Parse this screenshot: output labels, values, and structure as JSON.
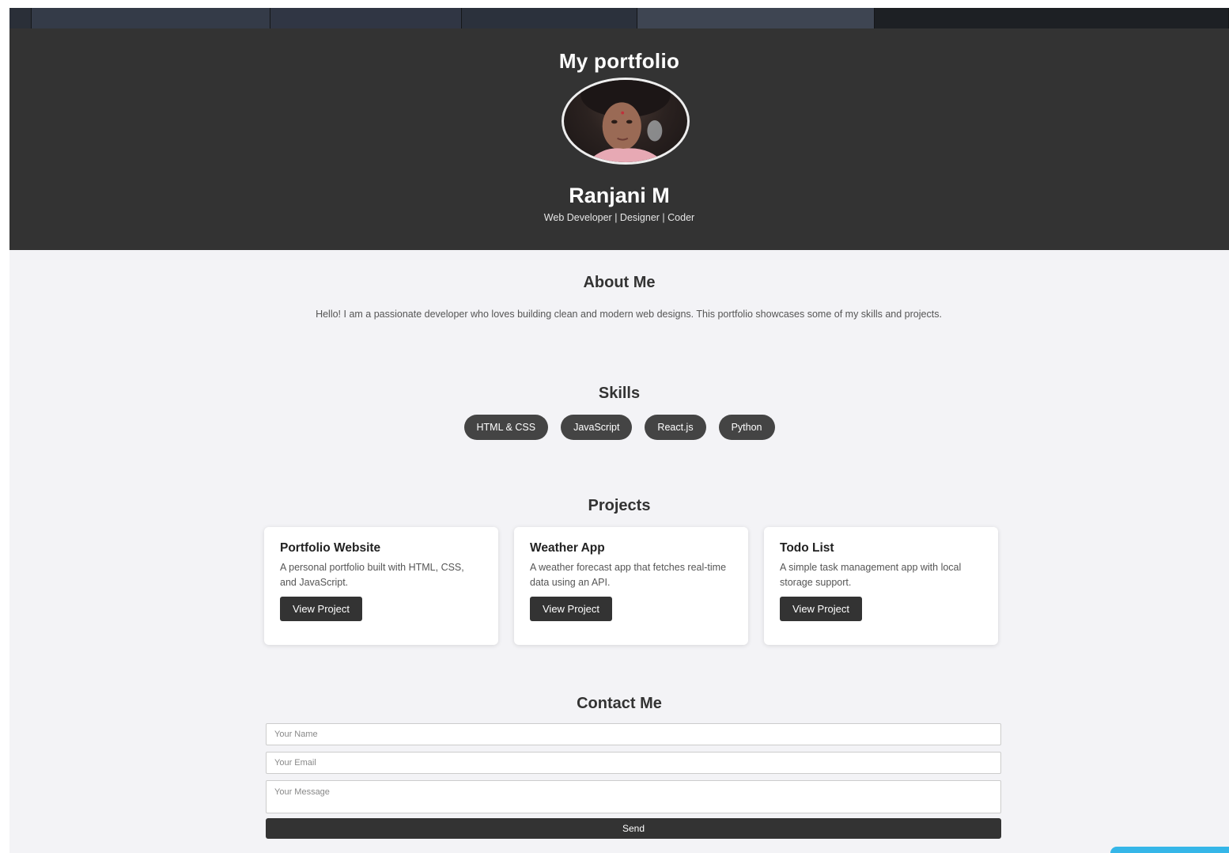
{
  "header": {
    "title": "My portfolio",
    "name": "Ranjani M",
    "tagline": "Web Developer | Designer | Coder"
  },
  "about": {
    "title": "About Me",
    "text": "Hello! I am a passionate developer who loves building clean and modern web designs. This portfolio showcases some of my skills and projects."
  },
  "skills": {
    "title": "Skills",
    "items": [
      "HTML & CSS",
      "JavaScript",
      "React.js",
      "Python"
    ]
  },
  "projects": {
    "title": "Projects",
    "items": [
      {
        "name": "Portfolio Website",
        "description": "A personal portfolio built with HTML, CSS, and JavaScript.",
        "button": "View Project"
      },
      {
        "name": "Weather App",
        "description": "A weather forecast app that fetches real-time data using an API.",
        "button": "View Project"
      },
      {
        "name": "Todo List",
        "description": "A simple task management app with local storage support.",
        "button": "View Project"
      }
    ]
  },
  "contact": {
    "title": "Contact Me",
    "name_placeholder": "Your Name",
    "email_placeholder": "Your Email",
    "message_placeholder": "Your Message",
    "send_label": "Send"
  },
  "icons": {
    "avatar": "profile-photo"
  },
  "colors": {
    "header_bg": "#333333",
    "page_bg": "#f3f3f6",
    "pill_bg": "#444444",
    "button_bg": "#333333",
    "accent": "#35b6e8"
  }
}
